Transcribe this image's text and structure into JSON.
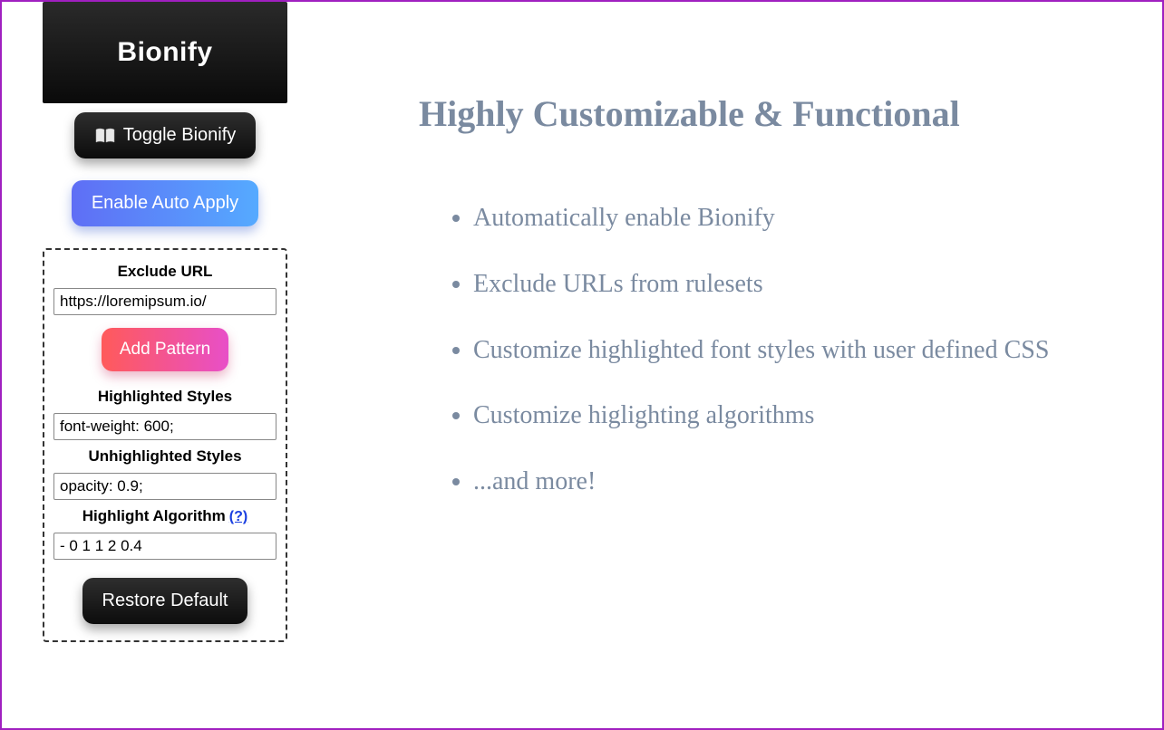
{
  "brand": {
    "title": "Bionify"
  },
  "buttons": {
    "toggle_label": "Toggle Bionify",
    "auto_apply_label": "Enable Auto Apply",
    "add_pattern_label": "Add Pattern",
    "restore_label": "Restore Default"
  },
  "settings": {
    "exclude_url": {
      "label": "Exclude URL",
      "value": "https://loremipsum.io/"
    },
    "highlighted_styles": {
      "label": "Highlighted Styles",
      "value": "font-weight: 600;"
    },
    "unhighlighted_styles": {
      "label": "Unhighlighted Styles",
      "value": "opacity: 0.9;"
    },
    "highlight_algorithm": {
      "label": "Highlight Algorithm",
      "help": "(?)",
      "value": "- 0 1 1 2 0.4"
    }
  },
  "marketing": {
    "heading": "Highly Customizable & Functional",
    "bullets": [
      "Automatically enable Bionify",
      "Exclude URLs from rulesets",
      "Customize highlighted font styles with user defined CSS",
      "Customize higlighting algorithms",
      "...and more!"
    ]
  }
}
